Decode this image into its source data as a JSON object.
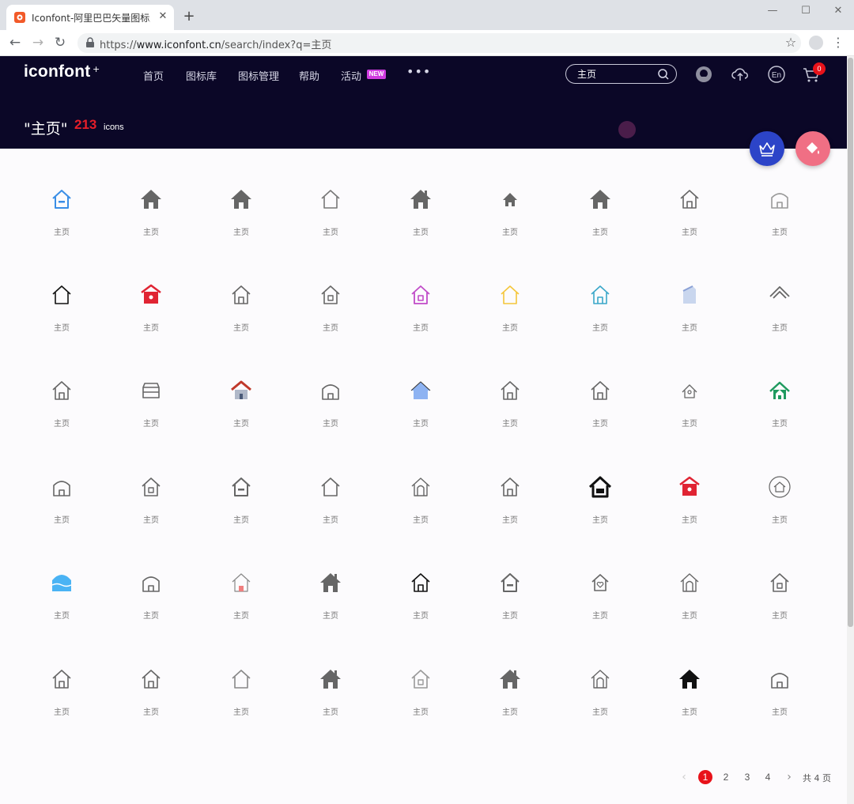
{
  "browser": {
    "tab_title": "Iconfont-阿里巴巴矢量图标库",
    "url_scheme": "https://",
    "url_host": "www.iconfont.cn",
    "url_path": "/search/index?q=主页"
  },
  "header": {
    "logo_text": "iconfont",
    "logo_mark": "+",
    "nav": [
      "首页",
      "图标库",
      "图标管理",
      "帮助",
      "活动"
    ],
    "new_badge": "NEW",
    "more": "•••",
    "search_value": "主页",
    "cart_count": "0"
  },
  "result": {
    "query": "\"主页\"",
    "count": "213",
    "unit": "icons"
  },
  "icons": {
    "label": "主页",
    "colors": {
      "gray": "#666666",
      "blue": "#3a8ee6",
      "red": "#e02433",
      "pink": "#c04bc8",
      "yellow": "#f4c63a",
      "teal": "#3aa7c9",
      "green": "#1f9a5f",
      "black": "#111111",
      "skyblue": "#4ab3f4"
    }
  },
  "pagination": {
    "prev": "‹",
    "next": "›",
    "pages": [
      "1",
      "2",
      "3",
      "4"
    ],
    "active": "1",
    "total": "共 4 页"
  }
}
